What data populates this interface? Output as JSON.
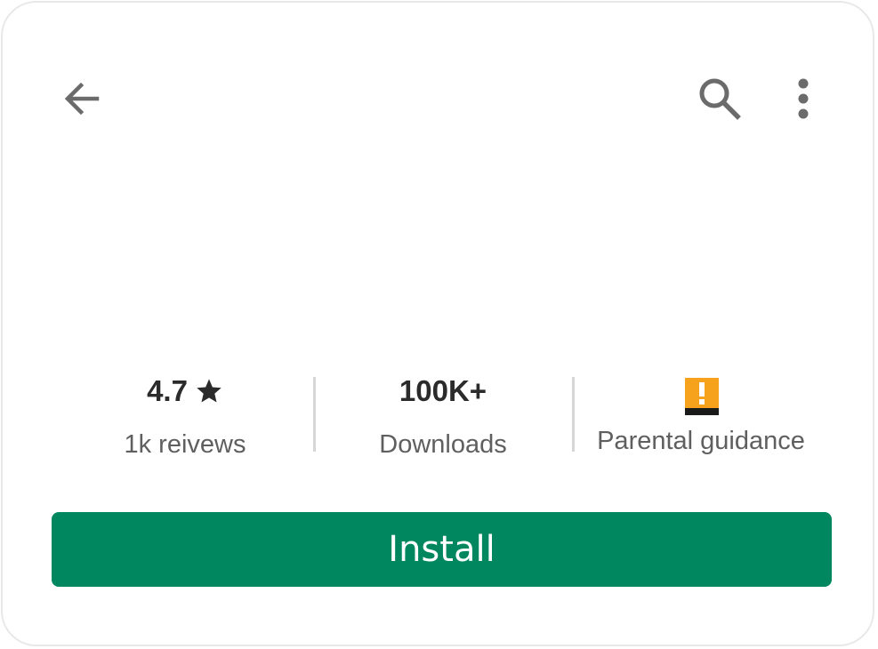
{
  "toolbar": {
    "back_icon": "arrow-left-icon",
    "search_icon": "search-icon",
    "more_icon": "more-vertical-icon",
    "icon_color": "#6b6b6b"
  },
  "stats": {
    "rating": {
      "value": "4.7",
      "icon": "star-icon",
      "label": "1k reivews"
    },
    "downloads": {
      "value": "100K+",
      "label": "Downloads"
    },
    "content_rating": {
      "icon": "parental-guidance-badge-icon",
      "badge_color": "#f6a21d",
      "label": "Parental guidance"
    }
  },
  "install": {
    "label": "Install",
    "color": "#01875f"
  }
}
